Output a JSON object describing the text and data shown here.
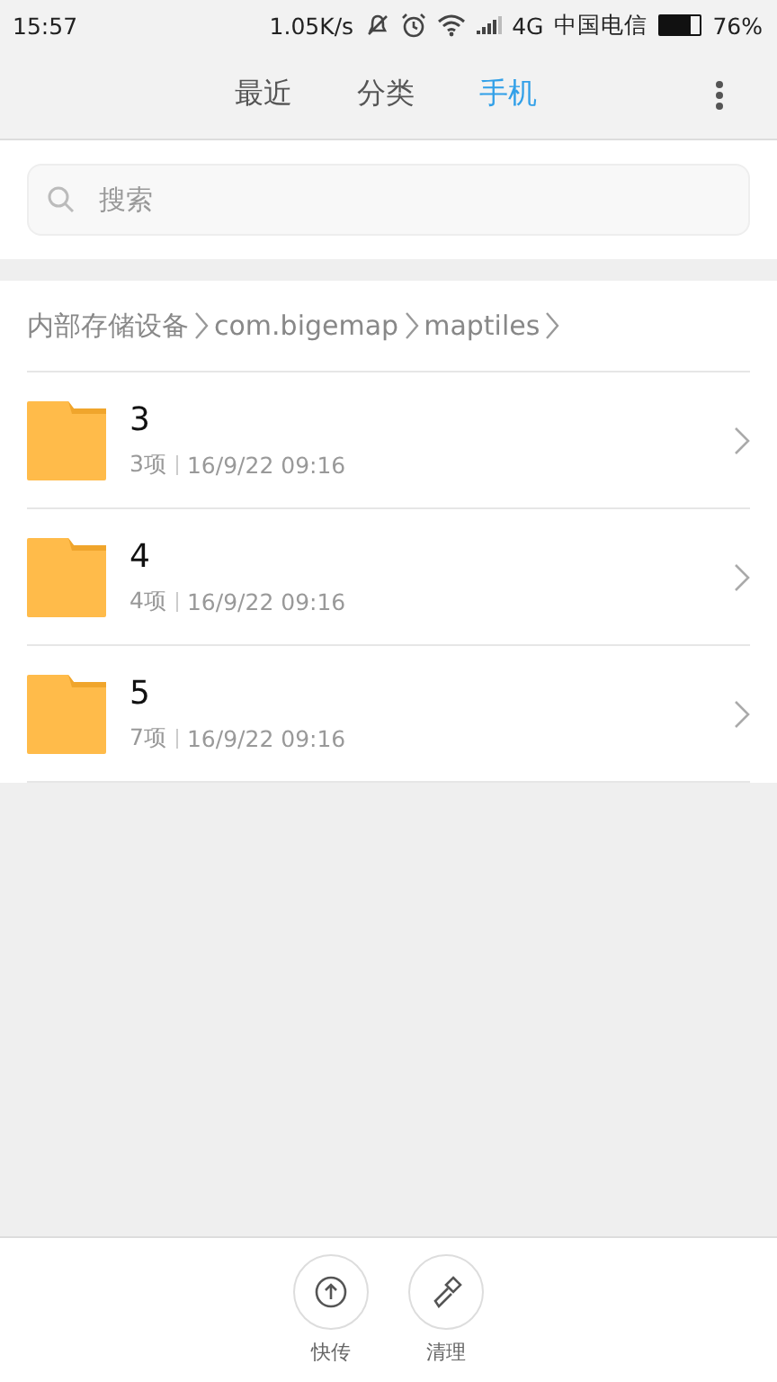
{
  "status_bar": {
    "time": "15:57",
    "speed": "1.05K/s",
    "network": "4G",
    "carrier": "中国电信",
    "battery": "76%"
  },
  "tabs": [
    {
      "label": "最近",
      "selected": false
    },
    {
      "label": "分类",
      "selected": false
    },
    {
      "label": "手机",
      "selected": true
    }
  ],
  "search": {
    "placeholder": "搜索"
  },
  "breadcrumb": [
    "内部存储设备",
    "com.bigemap",
    "maptiles"
  ],
  "folders": [
    {
      "name": "3",
      "count": "3项",
      "date": "16/9/22 09:16"
    },
    {
      "name": "4",
      "count": "4项",
      "date": "16/9/22 09:16"
    },
    {
      "name": "5",
      "count": "7项",
      "date": "16/9/22 09:16"
    }
  ],
  "actions": [
    {
      "kind": "upload",
      "label": "快传"
    },
    {
      "kind": "clean",
      "label": "清理"
    }
  ]
}
